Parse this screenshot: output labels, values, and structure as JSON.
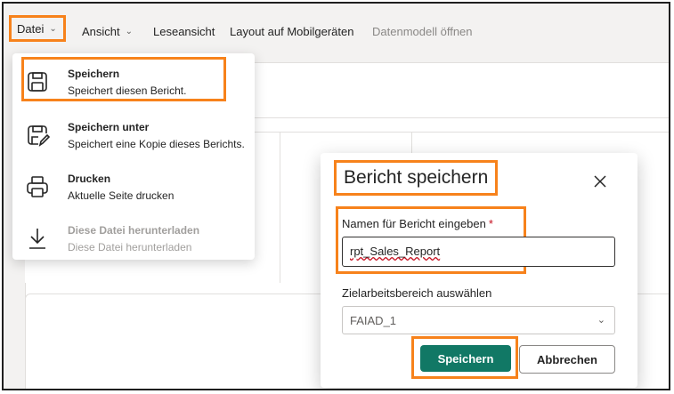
{
  "menubar": {
    "items": [
      {
        "label": "Datei",
        "has_chevron": true
      },
      {
        "label": "Ansicht",
        "has_chevron": true
      },
      {
        "label": "Leseansicht"
      },
      {
        "label": "Layout auf Mobilgeräten"
      },
      {
        "label": "Datenmodell öffnen",
        "disabled": true
      }
    ]
  },
  "file_menu": {
    "items": [
      {
        "icon": "save-icon",
        "title": "Speichern",
        "description": "Speichert diesen Bericht."
      },
      {
        "icon": "save-as-icon",
        "title": "Speichern unter",
        "description": "Speichert eine Kopie dieses Berichts."
      },
      {
        "icon": "print-icon",
        "title": "Drucken",
        "description": "Aktuelle Seite drucken"
      },
      {
        "icon": "download-icon",
        "title": "Diese Datei herunterladen",
        "description": "Diese Datei herunterladen",
        "disabled": true
      }
    ]
  },
  "save_dialog": {
    "title": "Bericht speichern",
    "name_label": "Namen für Bericht eingeben",
    "required_marker": "*",
    "name_value": "rpt_Sales_Report",
    "workspace_label": "Zielarbeitsbereich auswählen",
    "workspace_value": "FAIAD_1",
    "save_button": "Speichern",
    "cancel_button": "Abbrechen"
  },
  "colors": {
    "highlight": "#f7821b",
    "primary_button": "#117865",
    "required": "#c50f1f"
  }
}
